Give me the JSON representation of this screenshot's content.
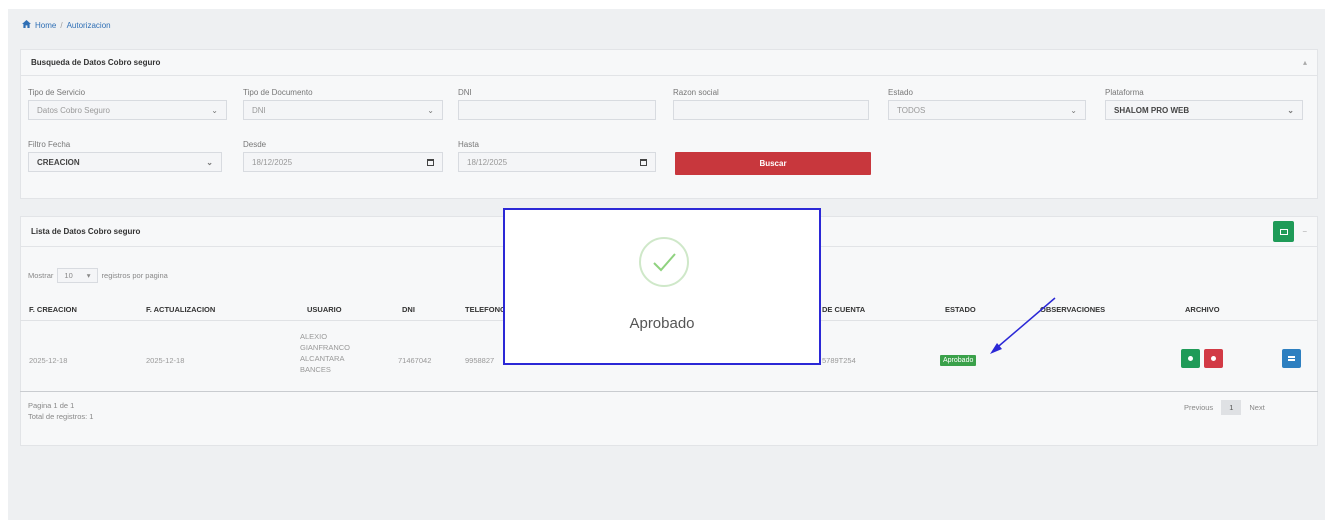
{
  "breadcrumb": {
    "home": "Home",
    "separator": "/",
    "current": "Autorizacion"
  },
  "search_panel": {
    "title": "Busqueda de Datos Cobro seguro",
    "tipo_servicio": {
      "label": "Tipo de Servicio",
      "value": "Datos Cobro Seguro"
    },
    "tipo_documento": {
      "label": "Tipo de Documento",
      "value": "DNI"
    },
    "dni": {
      "label": "DNI",
      "value": ""
    },
    "razon_social": {
      "label": "Razon social",
      "value": ""
    },
    "estado": {
      "label": "Estado",
      "value": "TODOS"
    },
    "plataforma": {
      "label": "Plataforma",
      "value": "SHALOM PRO WEB"
    },
    "filtro_fecha": {
      "label": "Filtro Fecha",
      "value": "CREACION"
    },
    "desde": {
      "label": "Desde",
      "value": "18/12/2025"
    },
    "hasta": {
      "label": "Hasta",
      "value": "18/12/2025"
    },
    "buscar_label": "Buscar"
  },
  "list_panel": {
    "title": "Lista de Datos Cobro seguro",
    "show_prefix": "Mostrar",
    "page_size": "10",
    "show_suffix": "registros por pagina",
    "columns": [
      "F. CREACION",
      "F. ACTUALIZACION",
      "USUARIO",
      "DNI",
      "TELEFONO",
      "DE CUENTA",
      "ESTADO",
      "OBSERVACIONES",
      "ARCHIVO"
    ],
    "rows": [
      {
        "f_creacion": "2025-12-18",
        "f_actualizacion": "2025-12-18",
        "usuario": [
          "ALEXIO",
          "GIANFRANCO",
          "ALCANTARA",
          "BANCES"
        ],
        "dni": "71467042",
        "telefono": "9958827",
        "cuenta": "5789T254",
        "estado": "Aprobado"
      }
    ],
    "page_info": "Pagina 1 de 1",
    "total_info": "Total de registros: 1",
    "pager": {
      "previous": "Previous",
      "current": "1",
      "next": "Next"
    }
  },
  "modal": {
    "title": "Aprobado"
  },
  "colors": {
    "buscar": "#c8373d",
    "badge": "#3aa14a",
    "modal_border": "#2b28d6",
    "annotation_arrow": "#2b28d6"
  }
}
